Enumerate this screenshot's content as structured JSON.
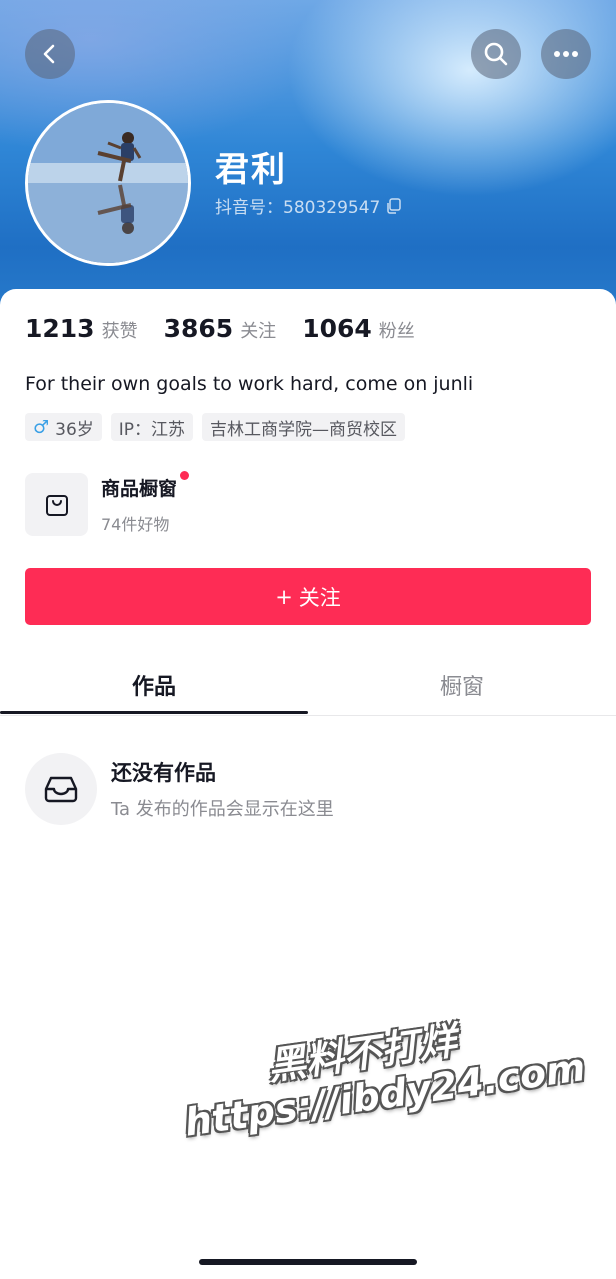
{
  "header": {
    "name": "君利",
    "douyin_id": "抖音号：580329547",
    "back_icon": "chevron-left-icon",
    "search_icon": "search-icon",
    "more_icon": "more-dots-icon"
  },
  "stats": [
    {
      "value": "1213",
      "label": "获赞"
    },
    {
      "value": "3865",
      "label": "关注"
    },
    {
      "value": "1064",
      "label": "粉丝"
    }
  ],
  "bio": "For their own goals to work hard, come on junli",
  "tags": {
    "gender_symbol": "♂",
    "age": "36岁",
    "ip": "IP：江苏",
    "school": "吉林工商学院—商贸校区"
  },
  "shop": {
    "title": "商品橱窗",
    "subtitle": "74件好物"
  },
  "follow_button": {
    "plus": "+",
    "label": "关注"
  },
  "tabs": [
    {
      "label": "作品",
      "active": true
    },
    {
      "label": "橱窗",
      "active": false
    }
  ],
  "empty_state": {
    "title": "还没有作品",
    "subtitle": "Ta 发布的作品会显示在这里"
  },
  "watermark": {
    "line1": "黑料不打烊",
    "line2": "https://ibdy24.com"
  },
  "colors": {
    "accent": "#fe2c55",
    "text_primary": "#161823",
    "text_secondary": "#8a8b91"
  }
}
